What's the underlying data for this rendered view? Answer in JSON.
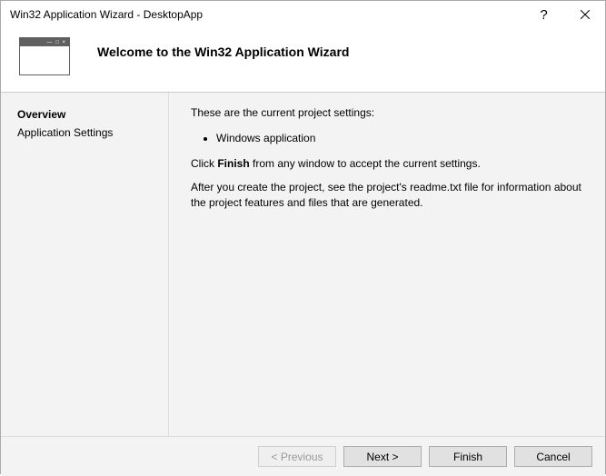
{
  "titlebar": {
    "title": "Win32 Application Wizard - DesktopApp",
    "help_label": "?",
    "close_label": "✕"
  },
  "header": {
    "title": "Welcome to the Win32 Application Wizard"
  },
  "sidebar": {
    "items": [
      {
        "label": "Overview",
        "active": true
      },
      {
        "label": "Application Settings",
        "active": false
      }
    ]
  },
  "content": {
    "intro": "These are the current project settings:",
    "bullets": [
      "Windows application"
    ],
    "instruction_pre": "Click ",
    "instruction_bold": "Finish",
    "instruction_post": " from any window to accept the current settings.",
    "note": "After you create the project, see the project's readme.txt file for information about the project features and files that are generated."
  },
  "footer": {
    "previous_label": "< Previous",
    "next_label": "Next >",
    "finish_label": "Finish",
    "cancel_label": "Cancel"
  }
}
